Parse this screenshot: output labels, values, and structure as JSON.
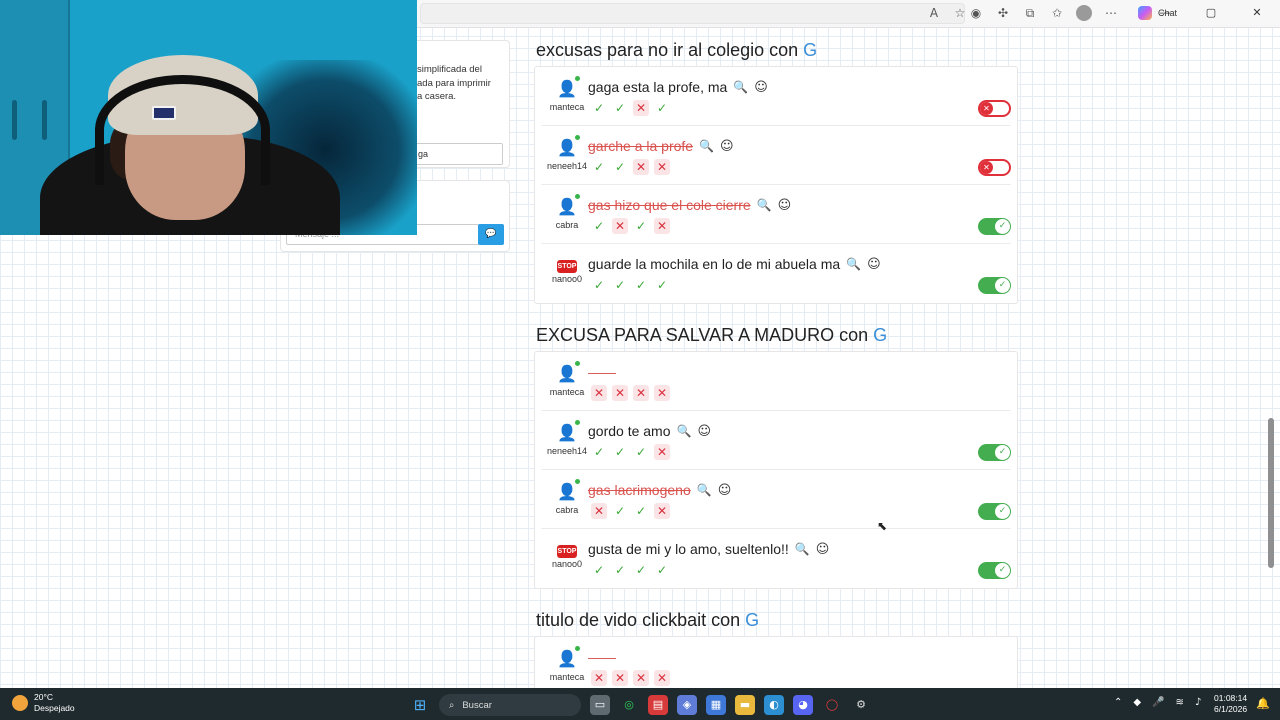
{
  "browser": {
    "chat_label": "Chat",
    "icons": [
      "read-aloud-icon",
      "favorite-icon",
      "extension-icon",
      "puzzle-icon",
      "collections-icon",
      "favorites-bar-icon",
      "profile-icon",
      "more-icon"
    ]
  },
  "side_panel": {
    "text_line1": "simplificada del",
    "text_line2": "ada para imprimir",
    "text_line3": "a casera.",
    "input_value": "ga",
    "message_placeholder": "Mensaje ..."
  },
  "sections": [
    {
      "title": "excusas para no ir al colegio con",
      "letter": "G",
      "rows": [
        {
          "user": "manteca",
          "avatar": "user",
          "answer": "gaga esta la profe, ma",
          "struck": false,
          "votes": [
            "ok",
            "ok",
            "no",
            "ok"
          ],
          "toggle": "off"
        },
        {
          "user": "neneeh14",
          "avatar": "user-star",
          "answer": "garche a la profe",
          "struck": true,
          "votes": [
            "ok",
            "ok",
            "no",
            "no"
          ],
          "toggle": "off"
        },
        {
          "user": "cabra",
          "avatar": "user",
          "answer": "gas hizo que el cole cierre",
          "struck": true,
          "votes": [
            "ok",
            "no",
            "ok",
            "no"
          ],
          "toggle": "on"
        },
        {
          "user": "nanoo0",
          "avatar": "stop",
          "answer": "guarde la mochila en lo de mi abuela ma",
          "struck": false,
          "votes": [
            "ok",
            "ok",
            "ok",
            "ok"
          ],
          "toggle": "on"
        }
      ]
    },
    {
      "title": "EXCUSA PARA SALVAR A MADURO con",
      "letter": "G",
      "rows": [
        {
          "user": "manteca",
          "avatar": "user",
          "answer": "",
          "struck": false,
          "votes": [
            "no",
            "no",
            "no",
            "no"
          ],
          "toggle": "none"
        },
        {
          "user": "neneeh14",
          "avatar": "user-star",
          "answer": "gordo te amo",
          "struck": false,
          "votes": [
            "ok",
            "ok",
            "ok",
            "no"
          ],
          "toggle": "on"
        },
        {
          "user": "cabra",
          "avatar": "user",
          "answer": "gas lacrimogeno",
          "struck": true,
          "votes": [
            "no",
            "ok",
            "ok",
            "no"
          ],
          "toggle": "on"
        },
        {
          "user": "nanoo0",
          "avatar": "stop",
          "answer": "gusta de mi y lo amo, sueltenlo!!",
          "struck": false,
          "votes": [
            "ok",
            "ok",
            "ok",
            "ok"
          ],
          "toggle": "on"
        }
      ]
    },
    {
      "title": "titulo de vido clickbait con",
      "letter": "G",
      "rows": [
        {
          "user": "manteca",
          "avatar": "user",
          "answer": "",
          "struck": false,
          "votes": [
            "no",
            "no",
            "no",
            "no"
          ],
          "toggle": "none"
        }
      ]
    }
  ],
  "stop_label": "STOP",
  "taskbar": {
    "weather_temp": "20°C",
    "weather_desc": "Despejado",
    "search_label": "Buscar",
    "time": "01:08:14",
    "date": "6/1/2026"
  },
  "colors": {
    "accent_blue": "#3a8fd8",
    "ok_green": "#3aa835",
    "no_red": "#d9333f",
    "toggle_on": "#43ad4f"
  }
}
